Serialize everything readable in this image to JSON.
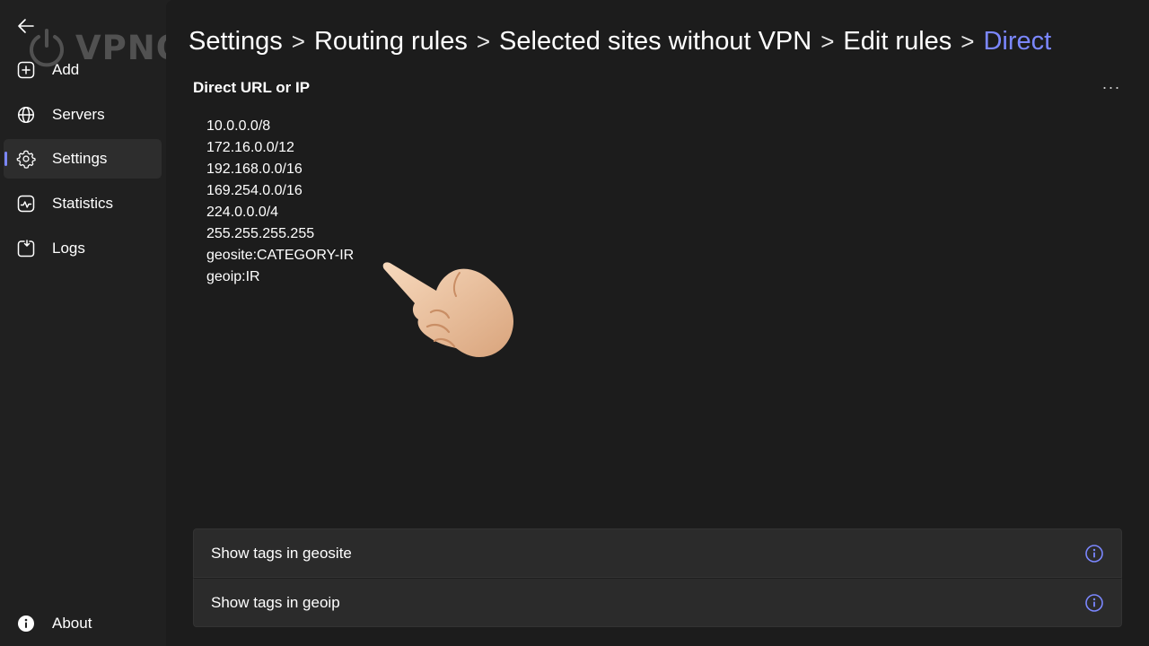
{
  "logo": {
    "text": "VPNON"
  },
  "sidebar": {
    "items": [
      {
        "label": "Add",
        "icon": "add-square-icon",
        "active": false
      },
      {
        "label": "Servers",
        "icon": "globe-icon",
        "active": false
      },
      {
        "label": "Settings",
        "icon": "gear-icon",
        "active": true
      },
      {
        "label": "Statistics",
        "icon": "chart-icon",
        "active": false
      },
      {
        "label": "Logs",
        "icon": "logs-icon",
        "active": false
      }
    ],
    "about": {
      "label": "About",
      "icon": "info-filled-icon"
    }
  },
  "breadcrumb": {
    "separator": ">",
    "items": [
      "Settings",
      "Routing rules",
      "Selected sites without VPN",
      "Edit rules"
    ],
    "current": "Direct"
  },
  "section": {
    "title": "Direct URL or IP",
    "more": "···"
  },
  "rules": [
    "10.0.0.0/8",
    "172.16.0.0/12",
    "192.168.0.0/16",
    "169.254.0.0/16",
    "224.0.0.0/4",
    "255.255.255.255",
    "geosite:CATEGORY-IR",
    "geoip:IR"
  ],
  "cards": [
    {
      "label": "Show tags in geosite",
      "icon": "info-icon"
    },
    {
      "label": "Show tags in geoip",
      "icon": "info-icon"
    }
  ],
  "colors": {
    "accent": "#7b87ff",
    "background": "#202020",
    "content_background": "#1c1c1c",
    "card": "#2b2b2b"
  }
}
